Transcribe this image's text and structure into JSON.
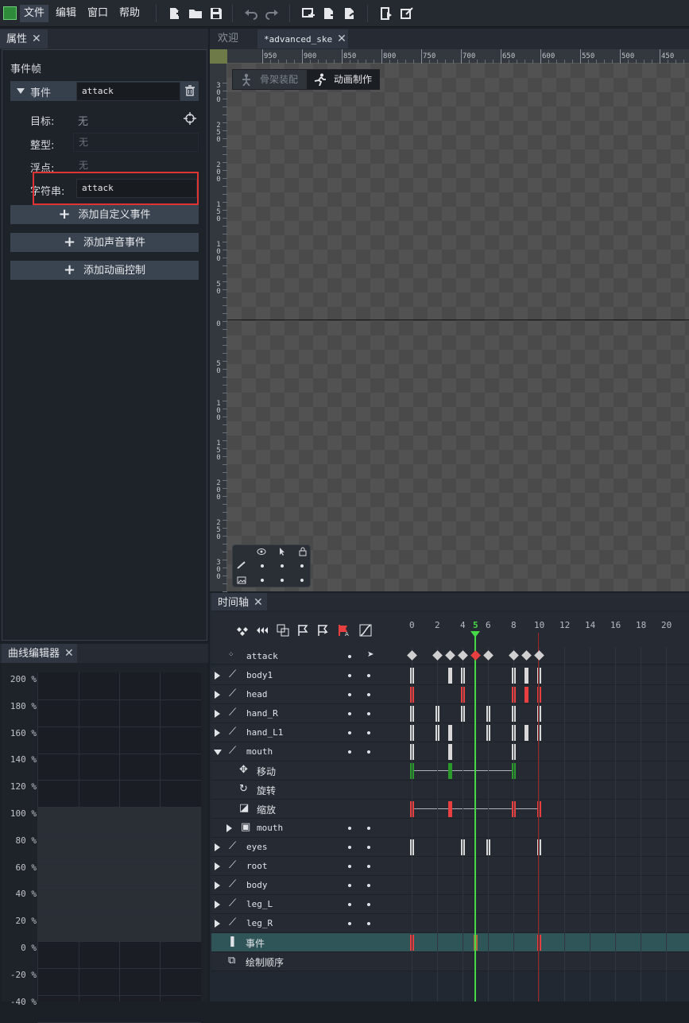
{
  "menu": {
    "file": "文件",
    "edit": "编辑",
    "window": "窗口",
    "help": "帮助"
  },
  "tabs": {
    "properties": "属性",
    "welcome": "欢迎",
    "document": "*advanced_ske",
    "timeline": "时间轴",
    "curve_editor": "曲线编辑器"
  },
  "properties": {
    "section_title": "事件帧",
    "event_label": "事件",
    "event_value": "attack",
    "target_label": "目标:",
    "target_value": "无",
    "int_label": "整型:",
    "int_value": "无",
    "float_label": "浮点:",
    "float_value": "无",
    "string_label": "字符串:",
    "string_value": "attack",
    "add_custom": "添加自定义事件",
    "add_sound": "添加声音事件",
    "add_anim": "添加动画控制"
  },
  "mode_tabs": {
    "armature": "骨架装配",
    "animate": "动画制作"
  },
  "ruler_h": [
    "950",
    "900",
    "850",
    "800",
    "750",
    "700",
    "650",
    "600",
    "550",
    "500",
    "450"
  ],
  "ruler_v": [
    "300",
    "250",
    "200",
    "150",
    "100",
    "50",
    "0",
    "50",
    "100",
    "150",
    "200",
    "250",
    "300"
  ],
  "timeline": {
    "frames": [
      "0",
      "2",
      "4",
      "5",
      "6",
      "8",
      "10",
      "12",
      "14",
      "16",
      "18",
      "20"
    ],
    "current_frame": "5",
    "tracks": [
      {
        "name": "attack"
      },
      {
        "name": "body1"
      },
      {
        "name": "head"
      },
      {
        "name": "hand_R"
      },
      {
        "name": "hand_L1"
      },
      {
        "name": "mouth"
      },
      {
        "name": "移动"
      },
      {
        "name": "旋转"
      },
      {
        "name": "缩放"
      },
      {
        "name": "mouth"
      },
      {
        "name": "eyes"
      },
      {
        "name": "root"
      },
      {
        "name": "body"
      },
      {
        "name": "leg_L"
      },
      {
        "name": "leg_R"
      },
      {
        "name": "事件"
      },
      {
        "name": "绘制顺序"
      }
    ]
  },
  "curve": {
    "labels": [
      "200 %",
      "180 %",
      "160 %",
      "140 %",
      "120 %",
      "100 %",
      "80 %",
      "60 %",
      "40 %",
      "20 %",
      "0 %",
      "-20 %",
      "-40 %"
    ]
  },
  "colors": {
    "accent_green": "#46d846",
    "highlight_red": "#e03434",
    "keyframe_red": "#e84040"
  }
}
